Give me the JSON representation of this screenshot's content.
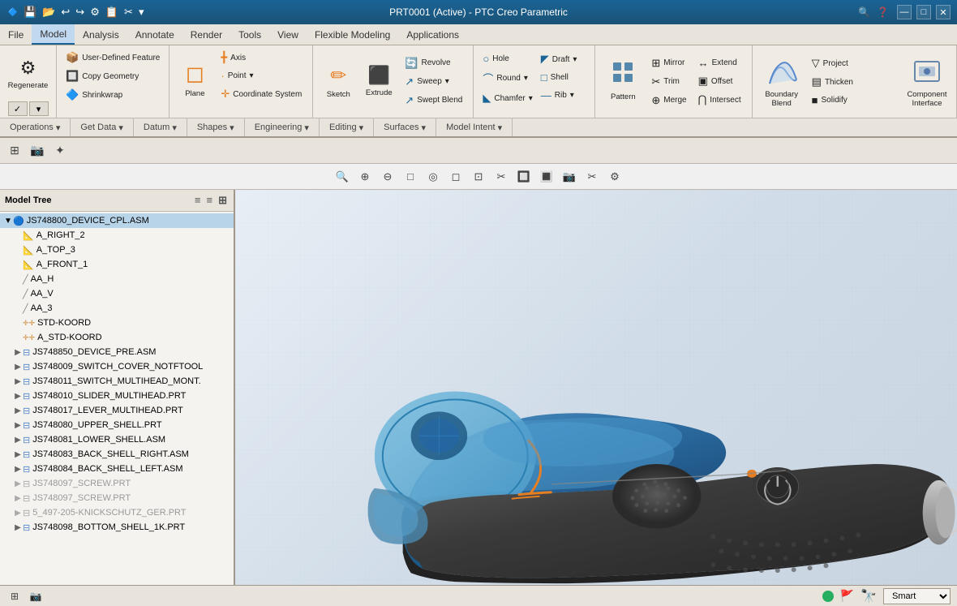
{
  "window": {
    "title": "PRT0001 (Active) - PTC Creo Parametric"
  },
  "titlebar": {
    "qat_icons": [
      "💾",
      "↩",
      "↪",
      "📋",
      "✂"
    ],
    "win_min": "—",
    "win_max": "□",
    "win_close": "✕"
  },
  "menubar": {
    "items": [
      {
        "label": "File",
        "active": false
      },
      {
        "label": "Model",
        "active": true
      },
      {
        "label": "Analysis",
        "active": false
      },
      {
        "label": "Annotate",
        "active": false
      },
      {
        "label": "Render",
        "active": false
      },
      {
        "label": "Tools",
        "active": false
      },
      {
        "label": "View",
        "active": false
      },
      {
        "label": "Flexible Modeling",
        "active": false
      },
      {
        "label": "Applications",
        "active": false
      }
    ]
  },
  "ribbon": {
    "groups": [
      {
        "id": "operations",
        "buttons_large": [
          {
            "label": "Regenerate",
            "icon": "⚙",
            "split": true
          }
        ],
        "buttons_small": [
          {
            "label": "Operations",
            "dropdown": true
          }
        ]
      },
      {
        "id": "get_data",
        "buttons_small": [
          {
            "label": "User-Defined Feature",
            "icon": "📦"
          },
          {
            "label": "Copy Geometry",
            "icon": "🔲"
          },
          {
            "label": "Shrinkwrap",
            "icon": "🔷"
          }
        ],
        "tab_label": "Get Data ▾"
      },
      {
        "id": "datum",
        "buttons_large": [
          {
            "label": "Plane",
            "icon": "◻"
          }
        ],
        "buttons_small": [
          {
            "label": "Axis",
            "icon": "╋"
          },
          {
            "label": "Point ▾",
            "icon": "·"
          },
          {
            "label": "Coordinate System",
            "icon": "✛"
          }
        ],
        "tab_label": "Datum ▾"
      },
      {
        "id": "shapes",
        "buttons_large": [
          {
            "label": "Sketch",
            "icon": "✏"
          },
          {
            "label": "Extrude",
            "icon": "⬛"
          }
        ],
        "buttons_small": [
          {
            "label": "Revolve",
            "icon": "🔄"
          },
          {
            "label": "Sweep ▾",
            "icon": "↗"
          },
          {
            "label": "Swept Blend",
            "icon": "↗"
          }
        ],
        "tab_label": "Shapes ▾"
      },
      {
        "id": "engineering",
        "buttons_small": [
          {
            "label": "Hole",
            "icon": "○"
          },
          {
            "label": "Round ▾",
            "icon": "⌒"
          },
          {
            "label": "Chamfer ▾",
            "icon": "◣"
          },
          {
            "label": "Draft ▾",
            "icon": "◤"
          },
          {
            "label": "Shell",
            "icon": "□"
          },
          {
            "label": "Rib",
            "icon": "—"
          }
        ],
        "tab_label": "Engineering ▾"
      },
      {
        "id": "editing",
        "buttons_large": [
          {
            "label": "Pattern",
            "icon": "⬛"
          }
        ],
        "buttons_small": [
          {
            "label": "Mirror",
            "icon": "⊞"
          },
          {
            "label": "Trim",
            "icon": "✂"
          },
          {
            "label": "Merge",
            "icon": "⊕"
          },
          {
            "label": "Extend",
            "icon": "↔"
          },
          {
            "label": "Offset",
            "icon": "▣"
          },
          {
            "label": "Intersect",
            "icon": "⋂"
          }
        ],
        "tab_label": "Editing ▾"
      },
      {
        "id": "surfaces",
        "buttons_large": [
          {
            "label": "Boundary Blend",
            "icon": "⬡"
          },
          {
            "label": "Component Interface",
            "icon": "🔌"
          }
        ],
        "buttons_small": [
          {
            "label": "Project",
            "icon": "▽"
          },
          {
            "label": "Thicken",
            "icon": "▤"
          },
          {
            "label": "Solidify",
            "icon": "■"
          }
        ],
        "tab_label": "Surfaces ▾"
      },
      {
        "id": "model_intent",
        "tab_label": "Model Intent ▾"
      }
    ]
  },
  "toolbar_strip": {
    "buttons": [
      "⊞",
      "📷",
      "✦"
    ]
  },
  "view_toolbar": {
    "buttons": [
      "🔍",
      "🔍+",
      "🔍-",
      "□",
      "○",
      "◻",
      "⊡",
      "✂",
      "🔲",
      "🔲",
      "📷",
      "✂",
      "⚙"
    ]
  },
  "model_tree": {
    "header": "Model Tree",
    "items": [
      {
        "id": "root",
        "label": "JS748800_DEVICE_CPL.ASM",
        "indent": 0,
        "icon": "🔵",
        "expand": true,
        "expanded": true
      },
      {
        "id": "a_right",
        "label": "A_RIGHT_2",
        "indent": 1,
        "icon": "📐"
      },
      {
        "id": "a_top",
        "label": "A_TOP_3",
        "indent": 1,
        "icon": "📐"
      },
      {
        "id": "a_front",
        "label": "A_FRONT_1",
        "indent": 1,
        "icon": "📐"
      },
      {
        "id": "aa_h",
        "label": "AA_H",
        "indent": 1,
        "icon": "📏"
      },
      {
        "id": "aa_v",
        "label": "AA_V",
        "indent": 1,
        "icon": "📏"
      },
      {
        "id": "aa_3",
        "label": "AA_3",
        "indent": 1,
        "icon": "📏"
      },
      {
        "id": "std_koord",
        "label": "STD-KOORD",
        "indent": 1,
        "icon": "✛"
      },
      {
        "id": "a_std_koord",
        "label": "A_STD-KOORD",
        "indent": 1,
        "icon": "✛"
      },
      {
        "id": "pre_asm",
        "label": "JS748850_DEVICE_PRE.ASM",
        "indent": 1,
        "icon": "🔵",
        "expand": true
      },
      {
        "id": "switch_cover",
        "label": "JS748009_SWITCH_COVER_NOTFTOOL",
        "indent": 1,
        "icon": "🔵",
        "expand": true
      },
      {
        "id": "switch_multi",
        "label": "JS748011_SWITCH_MULTIHEAD_MONT.",
        "indent": 1,
        "icon": "🔵",
        "expand": true
      },
      {
        "id": "slider",
        "label": "JS748010_SLIDER_MULTIHEAD.PRT",
        "indent": 1,
        "icon": "🔵",
        "expand": true
      },
      {
        "id": "lever",
        "label": "JS748017_LEVER_MULTIHEAD.PRT",
        "indent": 1,
        "icon": "🔵",
        "expand": true
      },
      {
        "id": "upper_shell",
        "label": "JS748080_UPPER_SHELL.PRT",
        "indent": 1,
        "icon": "🔵",
        "expand": true
      },
      {
        "id": "lower_shell",
        "label": "JS748081_LOWER_SHELL.ASM",
        "indent": 1,
        "icon": "🔵",
        "expand": true
      },
      {
        "id": "back_right",
        "label": "JS748083_BACK_SHELL_RIGHT.ASM",
        "indent": 1,
        "icon": "🔵",
        "expand": true
      },
      {
        "id": "back_left",
        "label": "JS748084_BACK_SHELL_LEFT.ASM",
        "indent": 1,
        "icon": "🔵",
        "expand": true
      },
      {
        "id": "screw1",
        "label": "JS748097_SCREW.PRT",
        "indent": 1,
        "icon": "⬜",
        "grayed": true,
        "expand": true
      },
      {
        "id": "screw2",
        "label": "JS748097_SCREW.PRT",
        "indent": 1,
        "icon": "⬜",
        "grayed": true,
        "expand": true
      },
      {
        "id": "knick",
        "label": "5_497-205-KNICKSCHUTZ_GER.PRT",
        "indent": 1,
        "icon": "⬜",
        "grayed": true,
        "expand": true
      },
      {
        "id": "bottom",
        "label": "JS748098_BOTTOM_SHELL_1K.PRT",
        "indent": 1,
        "icon": "🔵",
        "expand": true
      }
    ]
  },
  "statusbar": {
    "left_icons": [
      "⊞",
      "📷"
    ],
    "smart_label": "Smart",
    "dropdown_arrow": "▾"
  }
}
